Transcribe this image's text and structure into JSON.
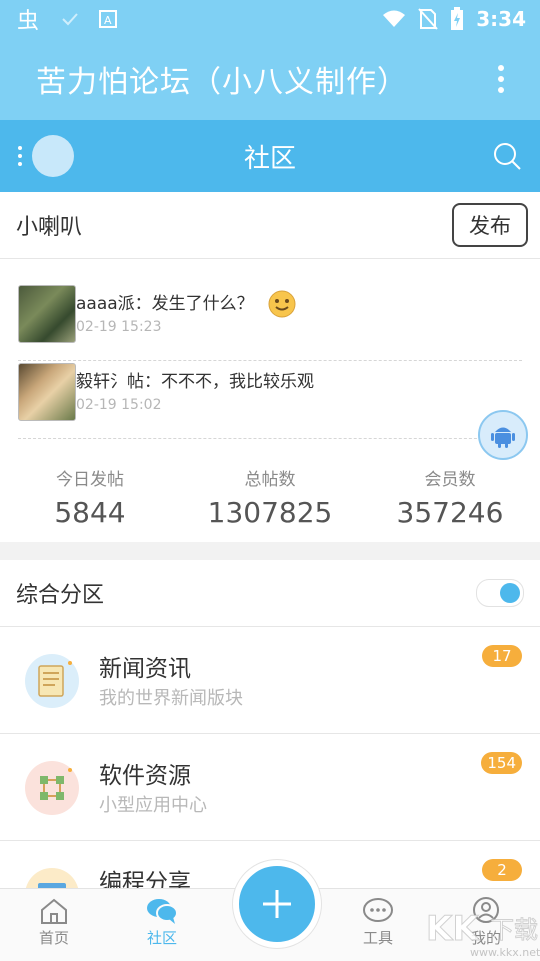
{
  "status_bar": {
    "time": "3:34",
    "icons": [
      "app-icon",
      "check-icon",
      "a-icon",
      "wifi-icon",
      "no-sim-icon",
      "battery-icon"
    ]
  },
  "app_bar": {
    "title": "苦力怕论坛（小八义制作）",
    "menu_icon": "more-vert-icon"
  },
  "tab_bar": {
    "title": "社区",
    "left_icon": "menu-icon",
    "search_icon": "search-icon"
  },
  "announcement": {
    "header": "小喇叭",
    "publish_label": "发布",
    "posts": [
      {
        "text": "aaaa派：发生了什么？",
        "time": "02-19 15:23",
        "emoji": "smile-emoji"
      },
      {
        "text": "毅轩氵帖：不不不，我比较乐观",
        "time": "02-19 15:02"
      }
    ]
  },
  "stats": [
    {
      "label": "今日发帖",
      "value": "5844"
    },
    {
      "label": "总帖数",
      "value": "1307825"
    },
    {
      "label": "会员数",
      "value": "357246"
    }
  ],
  "section": {
    "title": "综合分区",
    "toggle_on": true,
    "forums": [
      {
        "name": "新闻资讯",
        "desc": "我的世界新闻版块",
        "badge": "17",
        "icon": "news-icon",
        "icon_bg": "#dbeefa"
      },
      {
        "name": "软件资源",
        "desc": "小型应用中心",
        "badge": "154",
        "icon": "software-icon",
        "icon_bg": "#fbe2dc"
      },
      {
        "name": "编程分享",
        "desc": "",
        "badge": "2",
        "icon": "code-icon",
        "icon_bg": "#fcebc8"
      }
    ]
  },
  "bottom_nav": {
    "items": [
      {
        "label": "首页",
        "icon": "home-icon"
      },
      {
        "label": "社区",
        "icon": "community-icon",
        "active": true
      },
      {
        "label": "工具",
        "icon": "tools-icon"
      },
      {
        "label": "我的",
        "icon": "profile-icon"
      }
    ],
    "fab_icon": "plus-icon"
  },
  "colors": {
    "status_bar": "#7fd0f4",
    "tab_bar": "#4db8ec",
    "badge": "#f6ae3c",
    "accent": "#4db8ec"
  }
}
